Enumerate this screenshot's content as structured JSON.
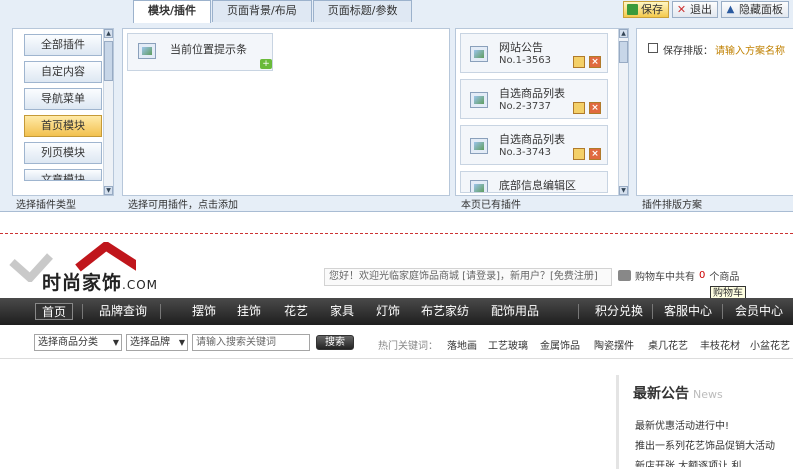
{
  "editor": {
    "tabs": [
      "模块/插件",
      "页面背景/布局",
      "页面标题/参数"
    ],
    "buttons": {
      "save": "保存",
      "exit": "退出",
      "hide": "隐藏面板"
    },
    "plugin_types": [
      "全部插件",
      "自定内容",
      "导航菜单",
      "首页模块",
      "列页模块",
      "文章模块"
    ],
    "plugin_types_caption": "选择插件类型",
    "available_caption": "选择可用插件，点击添加",
    "available_plugins": [
      {
        "label": "当前位置提示条"
      }
    ],
    "used_caption": "本页已有插件",
    "used_plugins": [
      {
        "name": "网站公告",
        "no": "No.1-3563"
      },
      {
        "name": "自选商品列表",
        "no": "No.2-3737"
      },
      {
        "name": "自选商品列表",
        "no": "No.3-3743"
      },
      {
        "name": "底部信息编辑区",
        "no": ""
      }
    ],
    "scheme_label": "保存排版：",
    "scheme_placeholder": "请输入方案名称",
    "scheme_caption": "插件排版方案"
  },
  "site": {
    "logo_text": "时尚家饰",
    "logo_com": ".COM",
    "welcome": "您好！欢迎光临家庭饰品商城 [请登录]，新用户？[免费注册]",
    "cart_text": "购物车中共有",
    "cart_count": "0",
    "cart_unit": "个商品",
    "cart_tooltip": "购物车",
    "nav": [
      "首页",
      "品牌查询",
      "摆饰",
      "挂饰",
      "花艺",
      "家具",
      "灯饰",
      "布艺家纺",
      "配饰用品",
      "积分兑换",
      "客服中心",
      "会员中心"
    ],
    "search": {
      "category": "选择商品分类",
      "brand": "选择品牌",
      "placeholder": "请输入搜索关键词",
      "button": "搜索",
      "hot_label": "热门关键词：",
      "hot": [
        "落地画",
        "工艺玻璃",
        "金属饰品",
        "陶瓷摆件",
        "桌几花艺",
        "丰枝花材",
        "小盆花艺"
      ]
    },
    "news": {
      "title": "最新公告",
      "title_en": "News",
      "items": [
        "最新优惠活动进行中!",
        "推出一系列花艺饰品促销大活动",
        "新店开张 大额逐项让 利..."
      ]
    }
  }
}
